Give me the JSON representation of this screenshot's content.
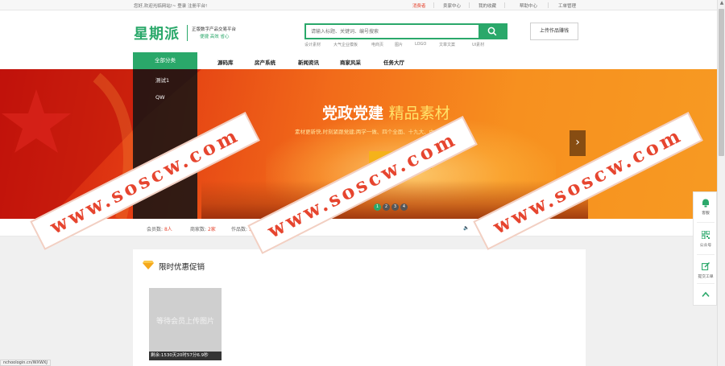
{
  "topbar": {
    "welcome": "您好,欢迎光临网站!~  登录 注册平台!",
    "links": [
      {
        "label": "消费者",
        "highlight": true
      },
      {
        "label": "卖家中心",
        "highlight": false
      },
      {
        "label": "我的收藏",
        "highlight": false
      },
      {
        "label": "帮助中心",
        "highlight": false
      },
      {
        "label": "工单管理",
        "highlight": false
      }
    ]
  },
  "header": {
    "logo": "星期派",
    "slogan": "正版数字产品交易平台",
    "slogan_sub": "便捷  高效  省心",
    "upload_label": "上传作品赚钱"
  },
  "search": {
    "placeholder": "请输入标题、关键词、编号搜索",
    "hotwords": [
      "设计素材",
      "大气企业模板",
      "电商页",
      "图片",
      "LOGO",
      "文章文案",
      "UI素材"
    ]
  },
  "nav": {
    "all_categories": "全部分类",
    "items": [
      "源码库",
      "房产系统",
      "新闻资讯",
      "商家风采",
      "任务大厅"
    ]
  },
  "categories": [
    "测试1",
    "QW"
  ],
  "banner": {
    "title_main": "党政党建",
    "title_accent": "精品素材",
    "subtitle": "素材更新快,时刻紧跟党建;两学一做、四个全面、十九大、中央全会",
    "arrow": "›",
    "dots": [
      "1",
      "2",
      "3",
      "4"
    ],
    "active_dot": 0
  },
  "stats": {
    "members_label": "会员数:",
    "members_value": "8人",
    "shops_label": "商家数:",
    "shops_value": "2家",
    "works_label": "作品数:",
    "works_value": "5"
  },
  "promo": {
    "title": "限时优惠促销",
    "product_placeholder": "等待会员上传图片",
    "product_caption": "剩余:1530天20时57分6.9秒"
  },
  "sidebar_tools": [
    {
      "label": "客服",
      "icon": "customer-service-icon"
    },
    {
      "label": "公众号",
      "icon": "qrcode-icon"
    },
    {
      "label": "提交工单",
      "icon": "edit-icon"
    }
  ],
  "watermark": "www.soscw.com",
  "statusbar_url": "nchoologin.cn/WXWXJ",
  "colors": {
    "accent": "#2aa86a",
    "highlight": "#e6452f",
    "banner": "#f26b1a"
  }
}
